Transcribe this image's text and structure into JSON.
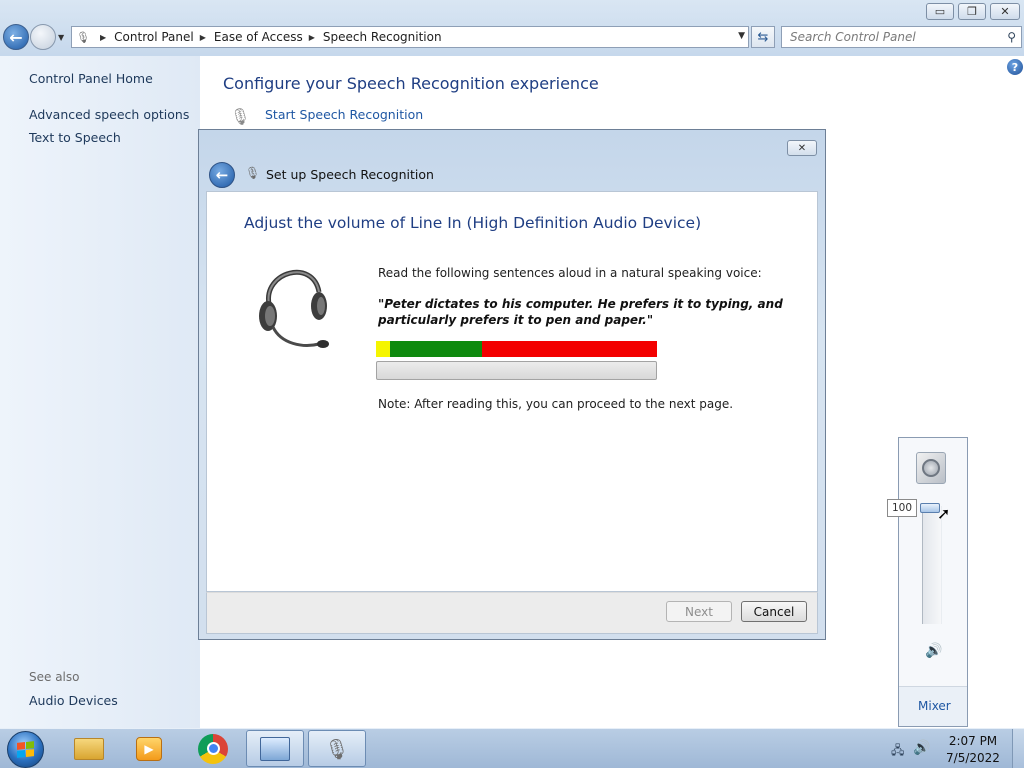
{
  "window": {
    "caption_buttons": {
      "minimize": "▭",
      "maximize": "❐",
      "close": "✕"
    },
    "breadcrumb": [
      "Control Panel",
      "Ease of Access",
      "Speech Recognition"
    ],
    "search_placeholder": "Search Control Panel"
  },
  "sidebar": {
    "home": "Control Panel Home",
    "links": [
      "Advanced speech options",
      "Text to Speech"
    ],
    "see_also_label": "See also",
    "see_also_links": [
      "Audio Devices"
    ]
  },
  "main": {
    "title": "Configure your Speech Recognition experience",
    "start_link": "Start Speech Recognition"
  },
  "dialog": {
    "title": "Set up Speech Recognition",
    "heading": "Adjust the volume of Line In (High Definition Audio Device)",
    "instruction": "Read the following sentences aloud in a natural speaking voice:",
    "quote": "\"Peter dictates to his computer. He prefers it to typing, and particularly prefers it to pen and paper.\"",
    "note": "Note: After reading this, you can proceed to the next page.",
    "progress_fraction": 0,
    "buttons": {
      "next": "Next",
      "cancel": "Cancel"
    },
    "next_enabled": false
  },
  "volume_popup": {
    "value": "100",
    "level_fraction": 1.0,
    "mixer_link": "Mixer"
  },
  "taskbar": {
    "apps": [
      "windows-explorer",
      "media-center",
      "google-chrome",
      "control-panel",
      "speech-recognition"
    ],
    "active_apps": [
      "control-panel",
      "speech-recognition"
    ],
    "clock_time": "2:07 PM",
    "clock_date": "7/5/2022"
  },
  "colors": {
    "link": "#1f57a3",
    "heading": "#1f3e83",
    "meter_yellow": "#f5f500",
    "meter_green": "#0e8a0e",
    "meter_red": "#f30000"
  }
}
